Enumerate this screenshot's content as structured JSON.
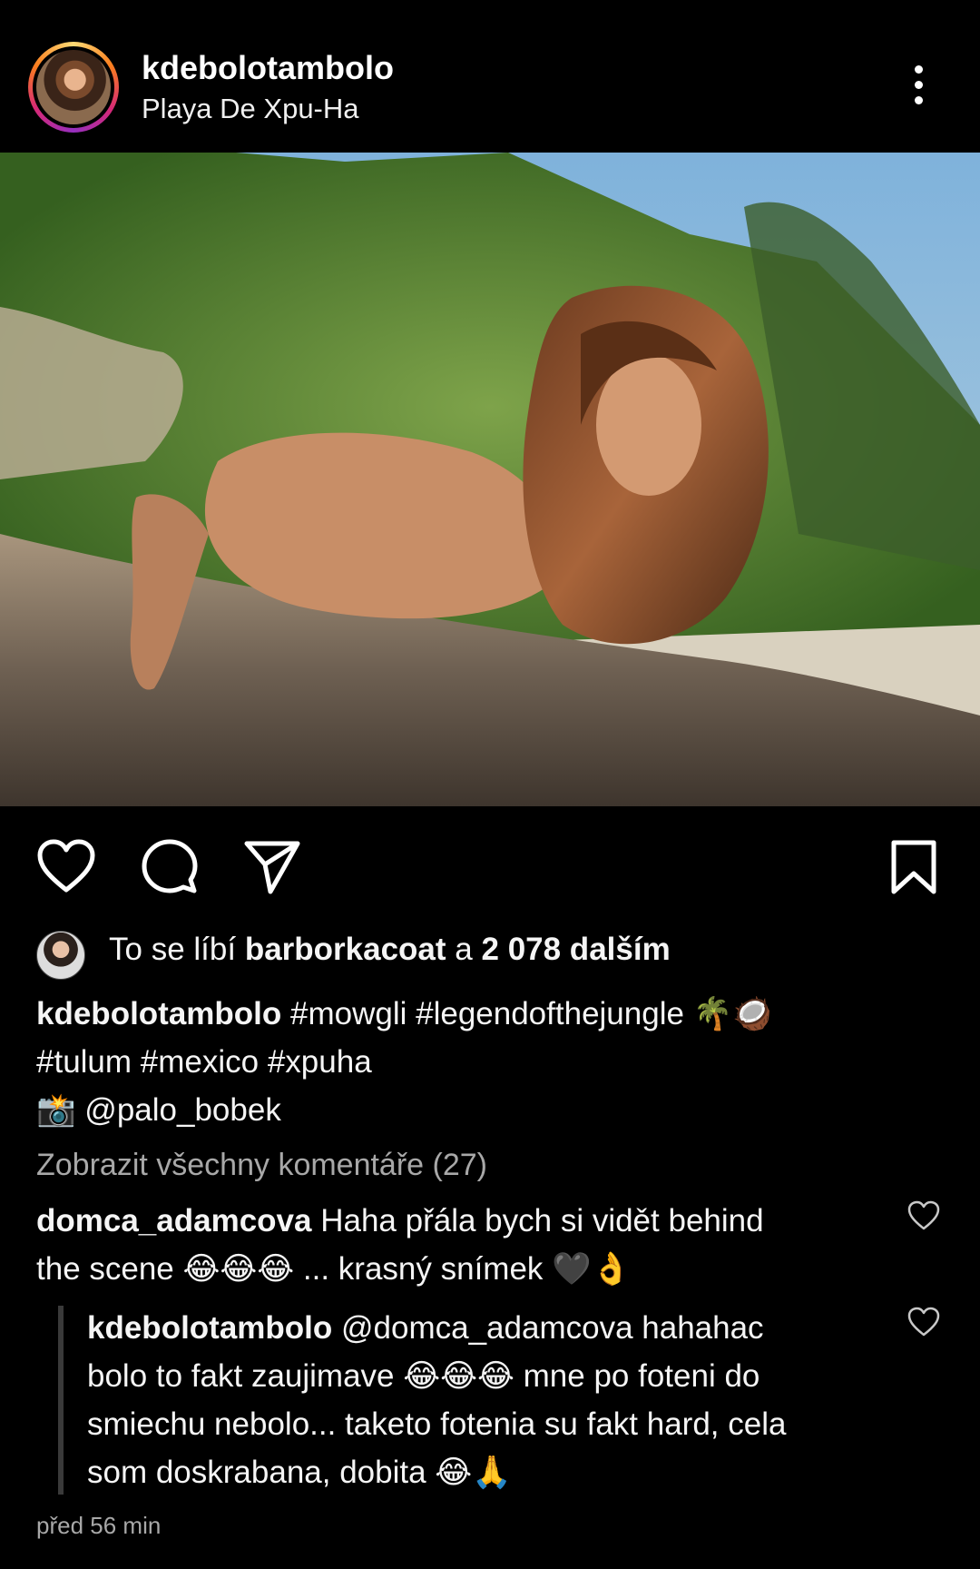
{
  "post": {
    "username": "kdebolotambolo",
    "location": "Playa De Xpu-Ha"
  },
  "likes": {
    "prefix": "To se líbí",
    "liker": "barborkacoat",
    "middle": "a",
    "count_text": "2 078 dalším"
  },
  "caption": {
    "username": "kdebolotambolo",
    "line1_text": "#mowgli #legendofthejungle 🌴🥥",
    "line2_text": "#tulum #mexico #xpuha",
    "line3_text": "📸 @palo_bobek"
  },
  "view_comments": "Zobrazit všechny komentáře (27)",
  "comments": [
    {
      "username": "domca_adamcova",
      "line1": "Haha přála bych si vidět behind",
      "line2": "the scene 😂😂😂 ... krasný snímek 🖤👌"
    },
    {
      "username": "kdebolotambolo",
      "line1": "@domca_adamcova hahahac",
      "line2": "bolo to fakt zaujimave 😂😂😂 mne po foteni do",
      "line3": "smiechu nebolo... taketo fotenia su fakt hard, cela",
      "line4": "som doskrabana, dobita 😂🙏"
    }
  ],
  "timestamp": "před 56 min",
  "icons": [
    "more-vertical-icon",
    "heart-icon",
    "comment-icon",
    "send-icon",
    "bookmark-icon"
  ],
  "colors": {
    "background": "#000000",
    "text": "#f5f5f5",
    "muted": "#a8a8a8"
  }
}
